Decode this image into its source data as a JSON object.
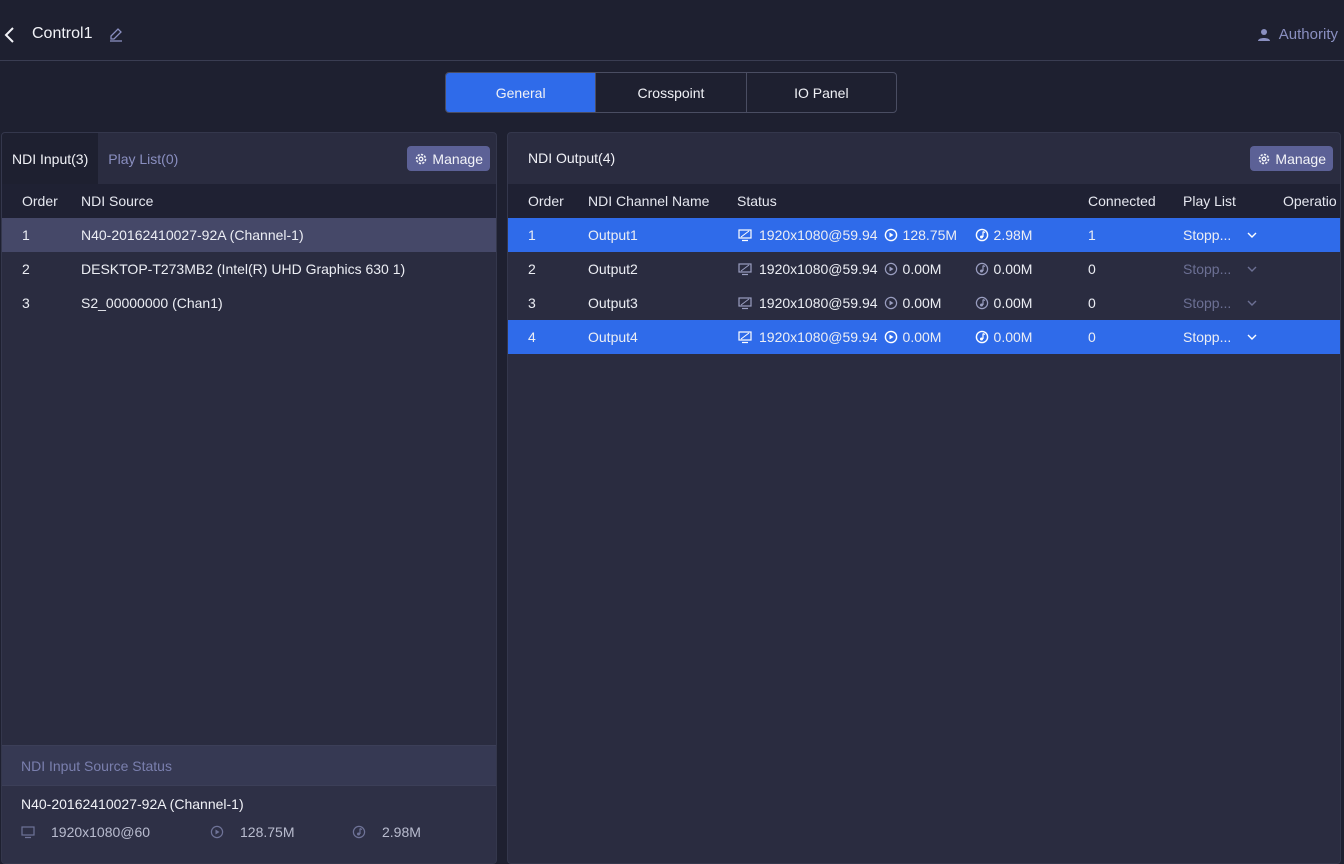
{
  "header": {
    "title": "Control1",
    "authority_label": "Authority"
  },
  "tabs": [
    {
      "label": "General",
      "active": true
    },
    {
      "label": "Crosspoint",
      "active": false
    },
    {
      "label": "IO Panel",
      "active": false
    }
  ],
  "left_panel": {
    "tabs": [
      {
        "label": "NDI Input(3)",
        "active": true
      },
      {
        "label": "Play List(0)",
        "active": false
      }
    ],
    "manage_label": "Manage",
    "columns": [
      "Order",
      "NDI Source"
    ],
    "rows": [
      {
        "order": "1",
        "source": "N40-20162410027-92A (Channel-1)"
      },
      {
        "order": "2",
        "source": "DESKTOP-T273MB2 (Intel(R) UHD Graphics 630 1)"
      },
      {
        "order": "3",
        "source": "S2_00000000 (Chan1)"
      }
    ],
    "source_status": {
      "heading": "NDI Input Source Status",
      "name": "N40-20162410027-92A (Channel-1)",
      "resolution": "1920x1080@60",
      "video_bitrate": "128.75M",
      "audio_bitrate": "2.98M"
    }
  },
  "right_panel": {
    "title": "NDI Output(4)",
    "manage_label": "Manage",
    "columns": [
      "Order",
      "NDI Channel Name",
      "Status",
      "Connected",
      "Play List",
      "Operatio"
    ],
    "rows": [
      {
        "order": "1",
        "name": "Output1",
        "resolution": "1920x1080@59.94",
        "video": "128.75M",
        "audio": "2.98M",
        "connected": "1",
        "playlist": "Stopp..."
      },
      {
        "order": "2",
        "name": "Output2",
        "resolution": "1920x1080@59.94",
        "video": "0.00M",
        "audio": "0.00M",
        "connected": "0",
        "playlist": "Stopp..."
      },
      {
        "order": "3",
        "name": "Output3",
        "resolution": "1920x1080@59.94",
        "video": "0.00M",
        "audio": "0.00M",
        "connected": "0",
        "playlist": "Stopp..."
      },
      {
        "order": "4",
        "name": "Output4",
        "resolution": "1920x1080@59.94",
        "video": "0.00M",
        "audio": "0.00M",
        "connected": "0",
        "playlist": "Stopp..."
      }
    ]
  },
  "colors": {
    "accent": "#2f6bea",
    "background": "#1e2030",
    "panel": "#2a2c40",
    "muted": "#8a8fc0"
  }
}
